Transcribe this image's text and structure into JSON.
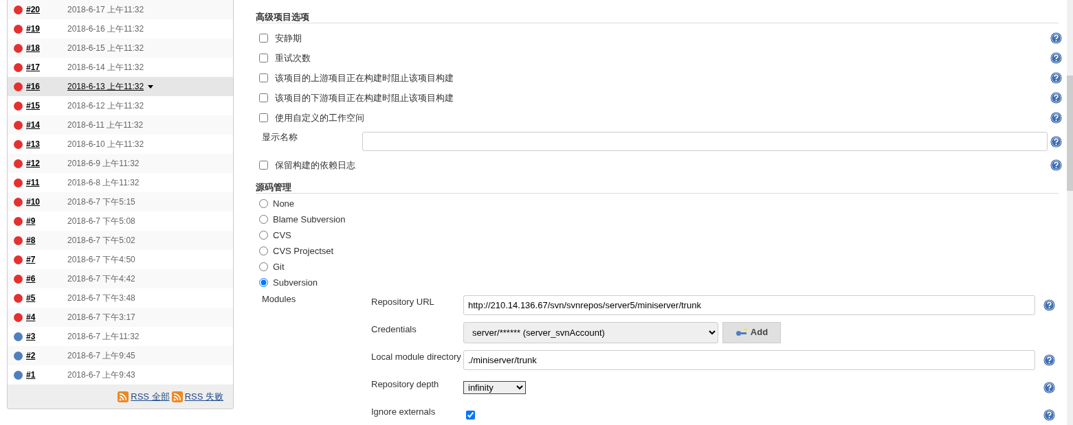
{
  "builds": [
    {
      "number": "#20",
      "time": "2018-6-17 上午11:32",
      "color": "#e53030",
      "selected": false
    },
    {
      "number": "#19",
      "time": "2018-6-16 上午11:32",
      "color": "#e53030",
      "selected": false
    },
    {
      "number": "#18",
      "time": "2018-6-15 上午11:32",
      "color": "#e53030",
      "selected": false
    },
    {
      "number": "#17",
      "time": "2018-6-14 上午11:32",
      "color": "#e53030",
      "selected": false
    },
    {
      "number": "#16",
      "time": "2018-6-13 上午11:32",
      "color": "#e53030",
      "selected": true
    },
    {
      "number": "#15",
      "time": "2018-6-12 上午11:32",
      "color": "#e53030",
      "selected": false
    },
    {
      "number": "#14",
      "time": "2018-6-11 上午11:32",
      "color": "#e53030",
      "selected": false
    },
    {
      "number": "#13",
      "time": "2018-6-10 上午11:32",
      "color": "#e53030",
      "selected": false
    },
    {
      "number": "#12",
      "time": "2018-6-9 上午11:32",
      "color": "#e53030",
      "selected": false
    },
    {
      "number": "#11",
      "time": "2018-6-8 上午11:32",
      "color": "#e53030",
      "selected": false
    },
    {
      "number": "#10",
      "time": "2018-6-7 下午5:15",
      "color": "#e53030",
      "selected": false
    },
    {
      "number": "#9",
      "time": "2018-6-7 下午5:08",
      "color": "#e53030",
      "selected": false
    },
    {
      "number": "#8",
      "time": "2018-6-7 下午5:02",
      "color": "#e53030",
      "selected": false
    },
    {
      "number": "#7",
      "time": "2018-6-7 下午4:50",
      "color": "#e53030",
      "selected": false
    },
    {
      "number": "#6",
      "time": "2018-6-7 下午4:42",
      "color": "#e53030",
      "selected": false
    },
    {
      "number": "#5",
      "time": "2018-6-7 下午3:48",
      "color": "#e53030",
      "selected": false
    },
    {
      "number": "#4",
      "time": "2018-6-7 下午3:17",
      "color": "#e53030",
      "selected": false
    },
    {
      "number": "#3",
      "time": "2018-6-7 上午11:32",
      "color": "#4f7fbf",
      "selected": false
    },
    {
      "number": "#2",
      "time": "2018-6-7 上午9:45",
      "color": "#4f7fbf",
      "selected": false
    },
    {
      "number": "#1",
      "time": "2018-6-7 上午9:43",
      "color": "#4f7fbf",
      "selected": false
    }
  ],
  "rss_links": [
    "RSS 全部",
    "RSS 失败"
  ],
  "advanced": {
    "title": "高级项目选项",
    "options": [
      {
        "kind": "checkbox",
        "label": "安静期",
        "checked": false
      },
      {
        "kind": "checkbox",
        "label": "重试次数",
        "checked": false
      },
      {
        "kind": "checkbox",
        "label": "该项目的上游项目正在构建时阻止该项目构建",
        "checked": false
      },
      {
        "kind": "checkbox",
        "label": "该项目的下游项目正在构建时阻止该项目构建",
        "checked": false
      },
      {
        "kind": "checkbox",
        "label": "使用自定义的工作空间",
        "checked": false
      },
      {
        "kind": "text",
        "label": "显示名称"
      },
      {
        "kind": "checkbox",
        "label": "保留构建的依赖日志",
        "checked": false
      }
    ]
  },
  "scm": {
    "title": "源码管理",
    "options": [
      {
        "label": "None",
        "selected": false
      },
      {
        "label": "Blame Subversion",
        "selected": false
      },
      {
        "label": "CVS",
        "selected": false
      },
      {
        "label": "CVS Projectset",
        "selected": false
      },
      {
        "label": "Git",
        "selected": false
      },
      {
        "label": "Subversion",
        "selected": true
      }
    ],
    "modules_label": "Modules",
    "fields": [
      {
        "kind": "text",
        "label": "Repository URL",
        "value": "http://210.14.136.67/svn/svnrepos/server5/miniserver/trunk",
        "help": true
      },
      {
        "kind": "credentials",
        "label": "Credentials",
        "value": "server/****** (server_svnAccount)",
        "button": "Add",
        "help": false
      },
      {
        "kind": "text",
        "label": "Local module directory",
        "value": "./miniserver/trunk",
        "help": true
      },
      {
        "kind": "select",
        "label": "Repository depth",
        "value": "infinity",
        "help": true
      },
      {
        "kind": "checkbox",
        "label": "Ignore externals",
        "checked": true,
        "help": true
      }
    ]
  }
}
